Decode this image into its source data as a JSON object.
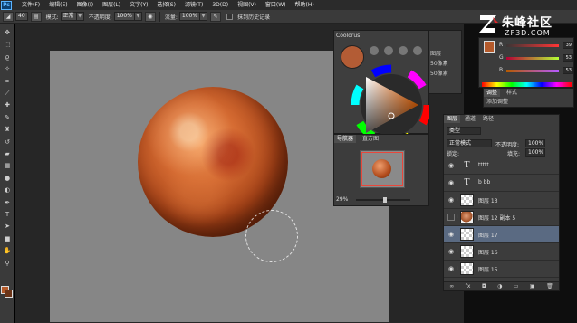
{
  "app": {
    "logo": "Ps"
  },
  "menu": [
    "文件(F)",
    "编辑(E)",
    "图像(I)",
    "图层(L)",
    "文字(Y)",
    "选择(S)",
    "滤镜(T)",
    "3D(D)",
    "视图(V)",
    "窗口(W)",
    "帮助(H)"
  ],
  "options": {
    "size": "40",
    "mode_label": "模式:",
    "mode_value": "正常",
    "opacity_label": "不透明度:",
    "opacity_value": "100%",
    "flow_label": "流量:",
    "flow_value": "100%",
    "history_label": "抹到历史记录"
  },
  "watermark": {
    "title": "朱峰社区",
    "url": "ZF3D.COM"
  },
  "color_panel": {
    "rows": [
      {
        "label": "R",
        "value": "39"
      },
      {
        "label": "G",
        "value": "53"
      },
      {
        "label": "B",
        "value": "53"
      }
    ],
    "swatch": "#b55a2b"
  },
  "adjustments": {
    "tabs": [
      "调整",
      "样式"
    ],
    "subtitle": "添加调整"
  },
  "coolorus": {
    "title": "Coolorus",
    "color": "#b35c35"
  },
  "side_panel": {
    "items": [
      "图层",
      "50像素",
      "50像素"
    ]
  },
  "navigator": {
    "tabs": [
      "导航器",
      "直方图"
    ],
    "zoom": "29%"
  },
  "layers": {
    "tabs": [
      "图层",
      "通道",
      "路径"
    ],
    "kind_label": "类型",
    "blend_mode": "正常模式",
    "opacity_label": "不透明度:",
    "opacity_value": "100%",
    "lock_label": "锁定:",
    "fill_label": "填充:",
    "fill_value": "100%",
    "items": [
      {
        "name": "ttttt",
        "kind": "type",
        "selected": false,
        "visible": true
      },
      {
        "name": "b bb",
        "kind": "type",
        "selected": false,
        "visible": true
      },
      {
        "name": "图层 13",
        "kind": "pixel",
        "selected": false,
        "visible": true
      },
      {
        "name": "图层 12 副本 5",
        "kind": "art",
        "selected": false,
        "visible": false
      },
      {
        "name": "图层 17",
        "kind": "pixel",
        "selected": true,
        "visible": true
      },
      {
        "name": "图层 16",
        "kind": "pixel",
        "selected": false,
        "visible": true
      },
      {
        "name": "图层 15",
        "kind": "pixel",
        "selected": false,
        "visible": true
      }
    ]
  },
  "toolbar_tools": [
    "move-icon",
    "marquee-icon",
    "lasso-icon",
    "quick-select-icon",
    "crop-icon",
    "eyedropper-icon",
    "healing-icon",
    "brush-icon",
    "clone-stamp-icon",
    "history-brush-icon",
    "eraser-icon",
    "gradient-icon",
    "blur-icon",
    "dodge-icon",
    "pen-icon",
    "type-icon",
    "path-select-icon",
    "shape-icon",
    "hand-icon",
    "zoom-icon"
  ],
  "colors": {
    "foreground": "#b45a2a",
    "background": "#6b3418",
    "canvas": "#868686"
  }
}
